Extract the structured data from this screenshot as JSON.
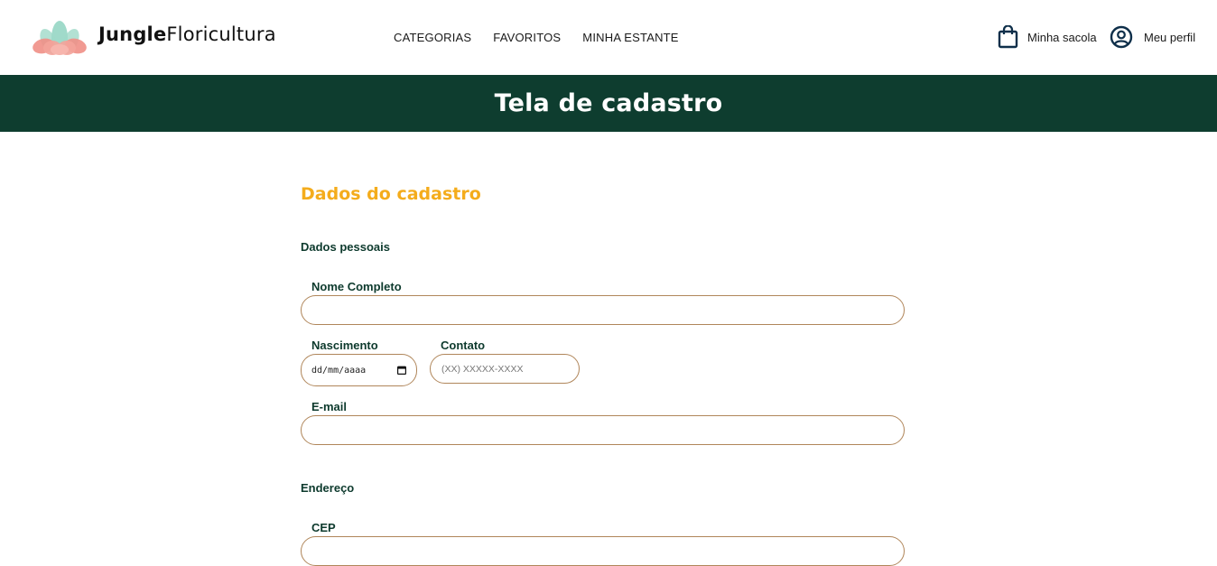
{
  "brand": {
    "name_bold": "Jungle",
    "name_thin": "Floricultura"
  },
  "nav": [
    {
      "label": "CATEGORIAS"
    },
    {
      "label": "FAVORITOS"
    },
    {
      "label": "MINHA ESTANTE"
    }
  ],
  "header_actions": {
    "bag_label": "Minha sacola",
    "profile_label": "Meu perfil"
  },
  "banner": {
    "title": "Tela de cadastro"
  },
  "form": {
    "section_title": "Dados do cadastro",
    "personal": {
      "title": "Dados pessoais",
      "full_name_label": "Nome Completo",
      "full_name_value": "",
      "birth_label": "Nascimento",
      "birth_placeholder": "dd/mm/aaaa",
      "contact_label": "Contato",
      "contact_placeholder": "(XX) XXXXX-XXXX",
      "email_label": "E-mail",
      "email_value": ""
    },
    "address": {
      "title": "Endereço",
      "cep_label": "CEP",
      "cep_value": ""
    }
  },
  "colors": {
    "banner_bg": "#0e3d2f",
    "accent": "#f4ac1c",
    "field_border": "#b0865a",
    "text_dark": "#0d3a2d"
  },
  "icons": [
    "lotus-logo-icon",
    "shopping-bag-icon",
    "user-circle-icon",
    "calendar-icon"
  ]
}
